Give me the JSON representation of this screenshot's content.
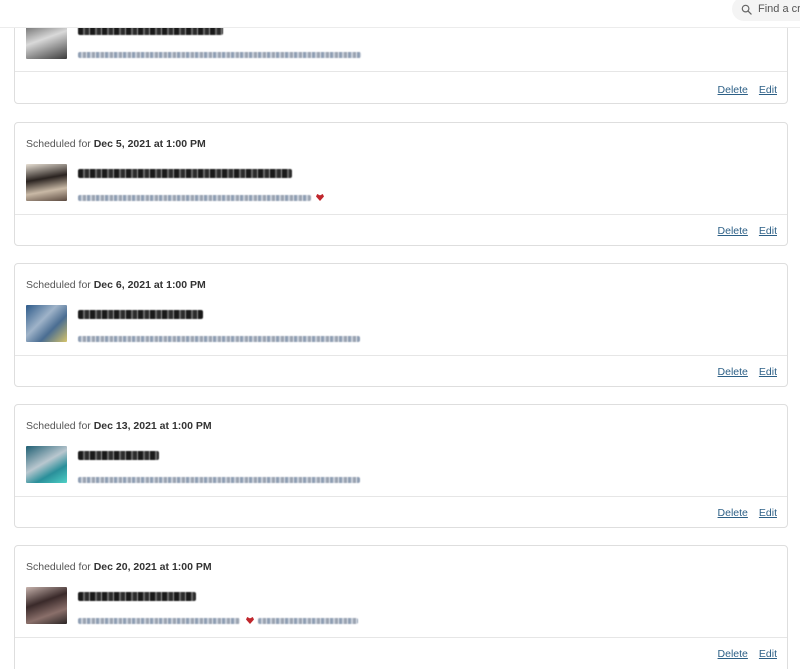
{
  "header": {
    "search_placeholder": "Find a creator",
    "search_icon": "magnifier-icon"
  },
  "actions": {
    "delete_label": "Delete",
    "edit_label": "Edit"
  },
  "scheduled_prefix": "Scheduled for",
  "posts": [
    {
      "scheduled_date": "",
      "thumb_colors": [
        "#3b3b3b",
        "#d9d9d9"
      ]
    },
    {
      "scheduled_date": "Dec 5, 2021 at 1:00 PM",
      "thumb_colors": [
        "#2a2320",
        "#c9b9a6"
      ]
    },
    {
      "scheduled_date": "Dec 6, 2021 at 1:00 PM",
      "thumb_colors": [
        "#2d5a8a",
        "#d6c46a"
      ]
    },
    {
      "scheduled_date": "Dec 13, 2021 at 1:00 PM",
      "thumb_colors": [
        "#1f5f73",
        "#4fd0c6"
      ]
    },
    {
      "scheduled_date": "Dec 20, 2021 at 1:00 PM",
      "thumb_colors": [
        "#3a2a2a",
        "#c7b3ad"
      ]
    }
  ]
}
